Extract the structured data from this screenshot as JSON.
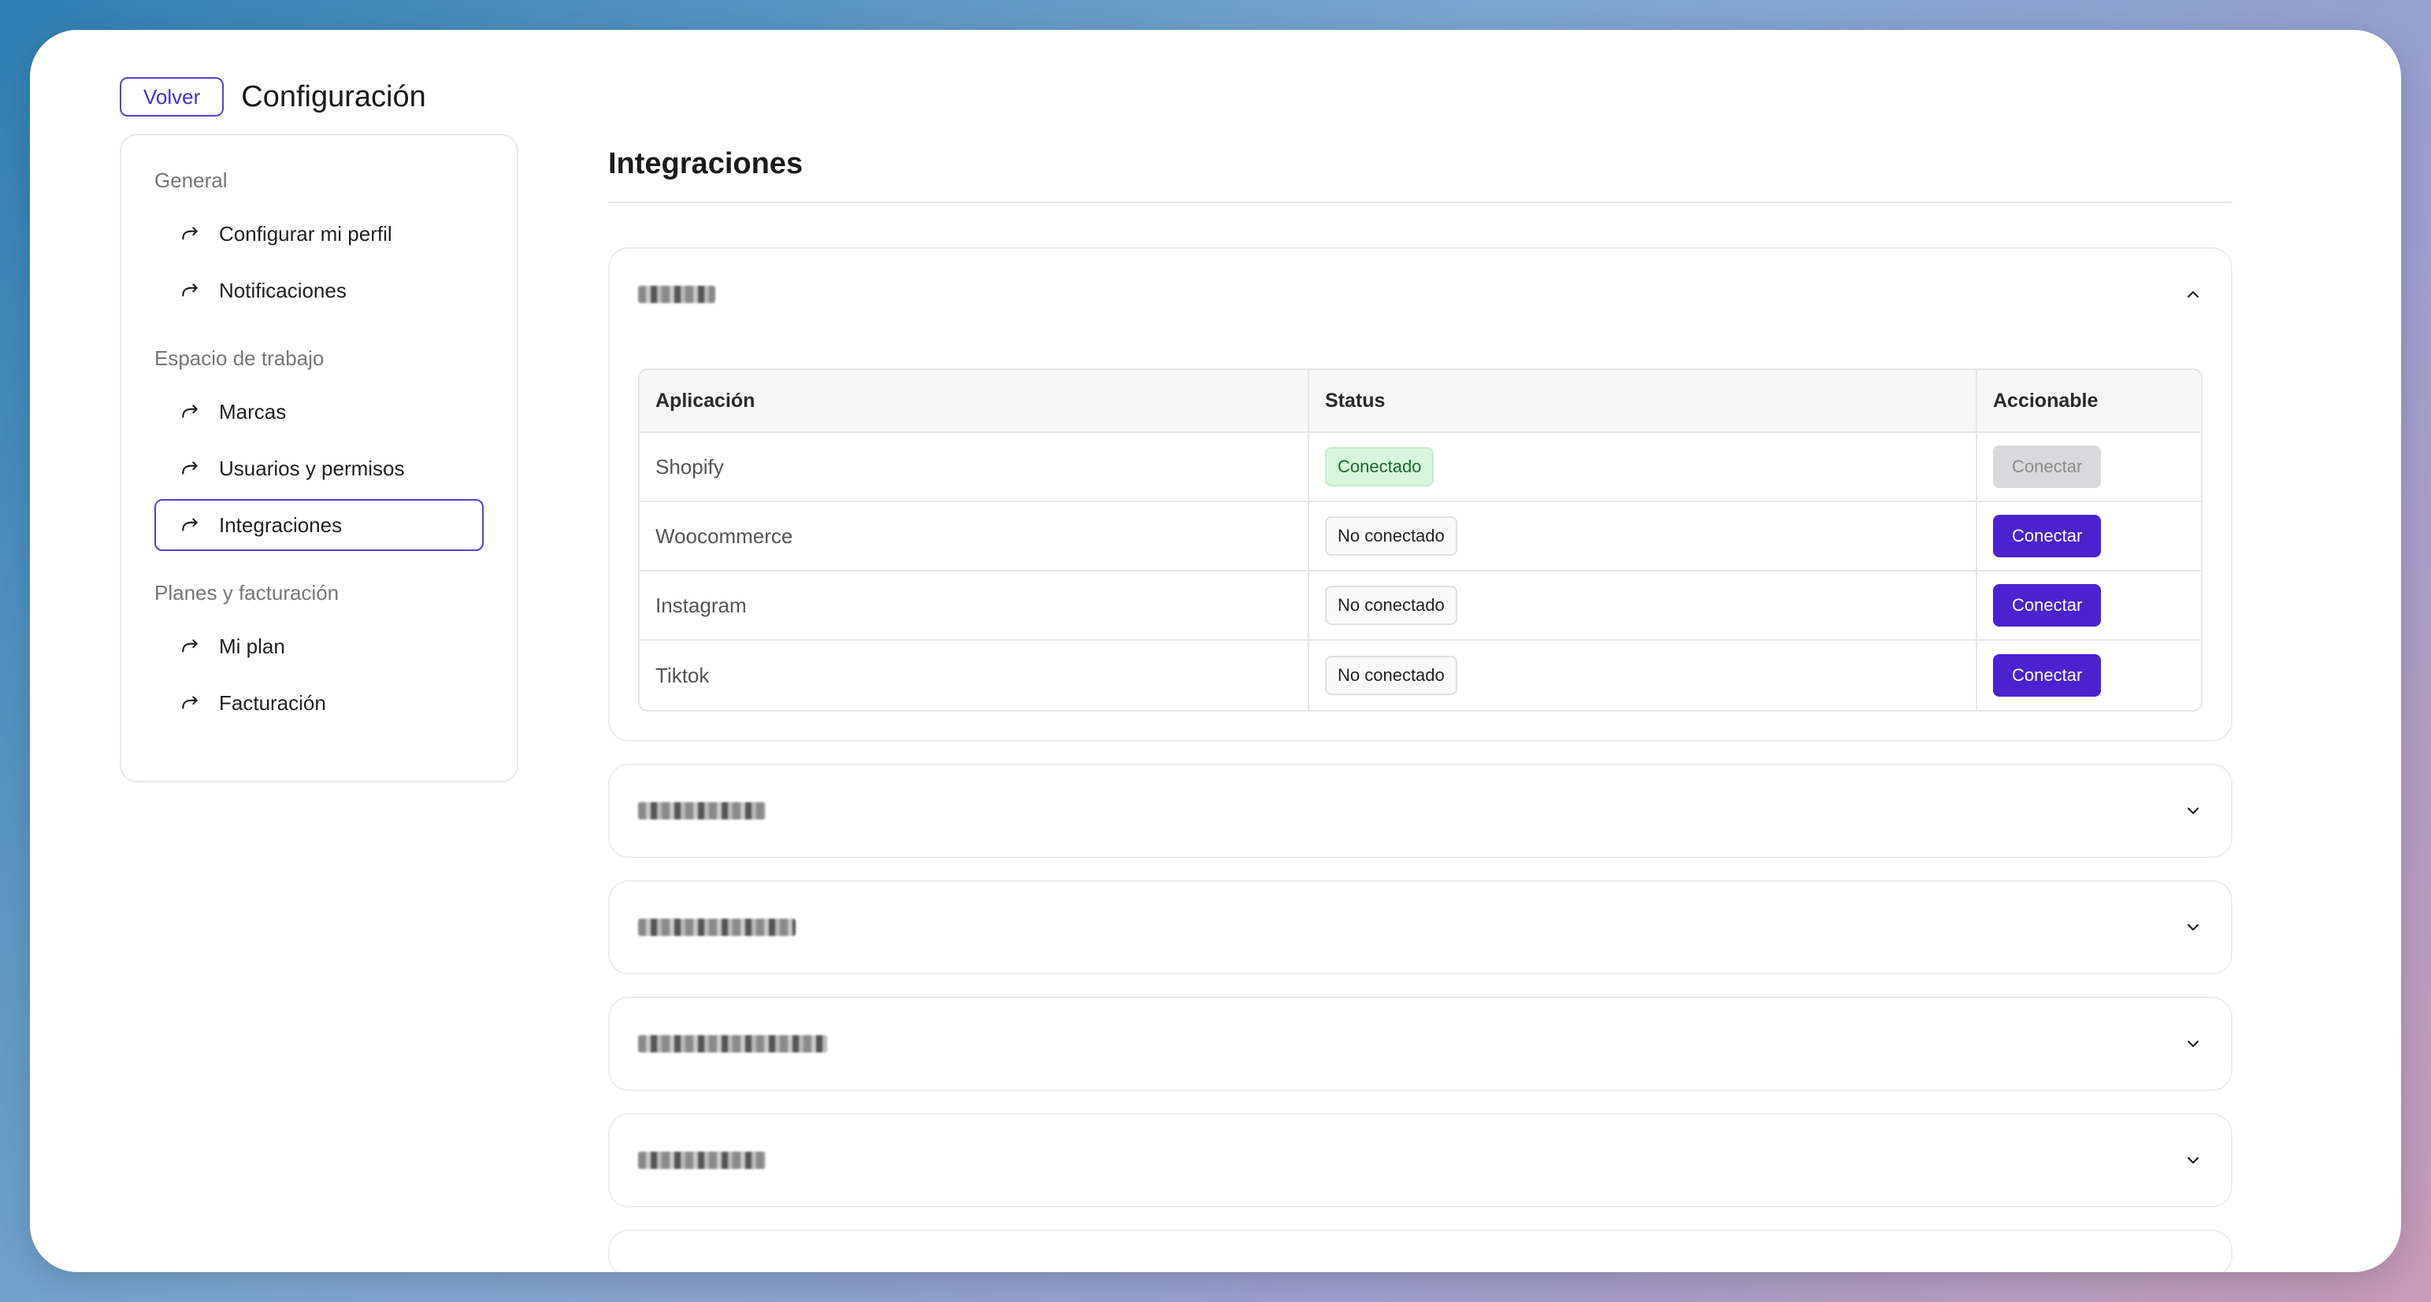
{
  "header": {
    "back_label": "Volver",
    "title": "Configuración"
  },
  "sidebar": {
    "sections": [
      {
        "label": "General",
        "items": [
          {
            "label": "Configurar mi perfil"
          },
          {
            "label": "Notificaciones"
          }
        ]
      },
      {
        "label": "Espacio de trabajo",
        "items": [
          {
            "label": "Marcas"
          },
          {
            "label": "Usuarios y permisos"
          },
          {
            "label": "Integraciones",
            "active": true
          }
        ]
      },
      {
        "label": "Planes y facturación",
        "items": [
          {
            "label": "Mi plan"
          },
          {
            "label": "Facturación"
          }
        ]
      }
    ]
  },
  "main": {
    "title": "Integraciones",
    "table": {
      "headers": [
        "Aplicación",
        "Status",
        "Accionable"
      ],
      "rows": [
        {
          "app": "Shopify",
          "status": "Conectado",
          "connected": true,
          "action": "Conectar"
        },
        {
          "app": "Woocommerce",
          "status": "No conectado",
          "connected": false,
          "action": "Conectar"
        },
        {
          "app": "Instagram",
          "status": "No conectado",
          "connected": false,
          "action": "Conectar"
        },
        {
          "app": "Tiktok",
          "status": "No conectado",
          "connected": false,
          "action": "Conectar"
        }
      ]
    }
  },
  "colors": {
    "accent": "#4a22cf",
    "connected_bg": "#d7f6dc"
  }
}
